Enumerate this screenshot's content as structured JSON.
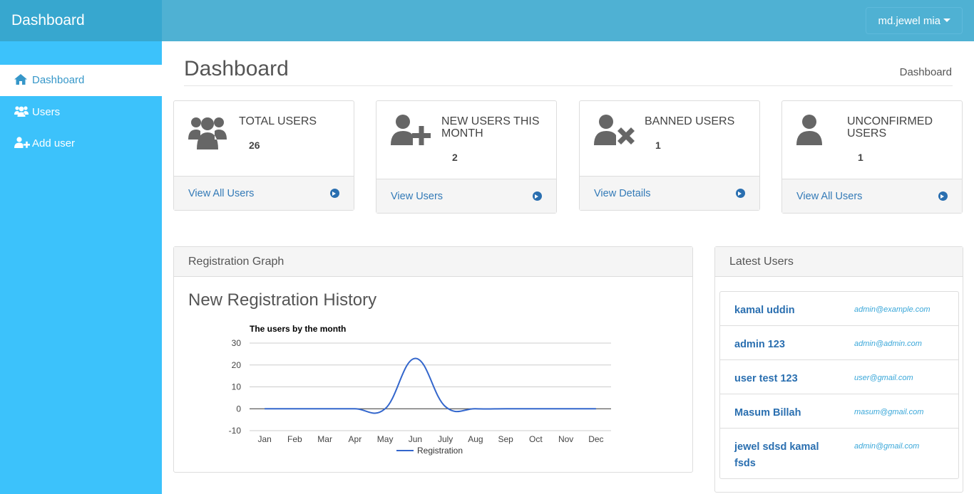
{
  "app": {
    "brand": "Dashboard",
    "user_menu": "md.jewel mia"
  },
  "sidebar": {
    "items": [
      {
        "label": "Dashboard",
        "icon": "home-icon",
        "active": true
      },
      {
        "label": "Users",
        "icon": "users-icon",
        "active": false
      },
      {
        "label": "Add user",
        "icon": "add-user-icon",
        "active": false
      }
    ]
  },
  "header": {
    "title": "Dashboard",
    "breadcrumb": "Dashboard"
  },
  "cards": [
    {
      "label": "TOTAL USERS",
      "value": "26",
      "link": "View All Users",
      "icon": "users-group-icon"
    },
    {
      "label": "NEW USERS THIS MONTH",
      "value": "2",
      "link": "View Users",
      "icon": "user-plus-icon"
    },
    {
      "label": "BANNED USERS",
      "value": "1",
      "link": "View Details",
      "icon": "user-times-icon"
    },
    {
      "label": "UNCONFIRMED USERS",
      "value": "1",
      "link": "View All Users",
      "icon": "user-icon"
    }
  ],
  "registration_panel": {
    "heading": "Registration Graph",
    "chart_heading": "New Registration History"
  },
  "latest_users_panel": {
    "heading": "Latest Users",
    "users": [
      {
        "name": "kamal uddin",
        "email": "admin@example.com"
      },
      {
        "name": "admin 123",
        "email": "admin@admin.com"
      },
      {
        "name": "user test 123",
        "email": "user@gmail.com"
      },
      {
        "name": "Masum Billah",
        "email": "masum@gmail.com"
      },
      {
        "name": "jewel sdsd kamal fsds",
        "email": "admin@gmail.com"
      }
    ]
  },
  "colors": {
    "topbar": "#4fb1d3",
    "sidebar": "#3cc2fb",
    "link": "#337ab7",
    "series": "#3366cc"
  },
  "chart_data": {
    "type": "line",
    "title": "The users by the month",
    "categories": [
      "Jan",
      "Feb",
      "Mar",
      "Apr",
      "May",
      "Jun",
      "July",
      "Aug",
      "Sep",
      "Oct",
      "Nov",
      "Dec"
    ],
    "series": [
      {
        "name": "Registration",
        "values": [
          0,
          0,
          0,
          0,
          0,
          23,
          1,
          0,
          0,
          0,
          0,
          0
        ]
      }
    ],
    "yticks": [
      30,
      20,
      10,
      0,
      -10
    ],
    "ylim": [
      -10,
      30
    ],
    "legend": "bottom",
    "grid": true
  }
}
